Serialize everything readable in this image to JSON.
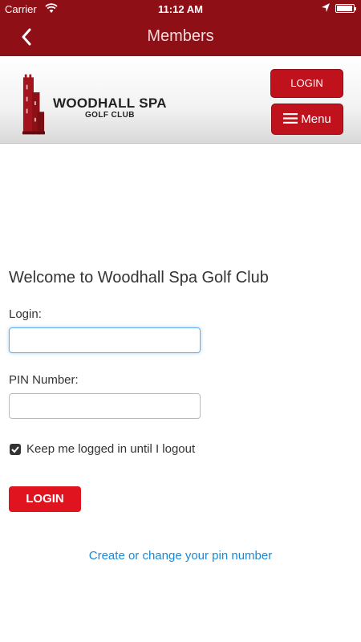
{
  "status_bar": {
    "carrier": "Carrier",
    "time": "11:12 AM"
  },
  "nav": {
    "title": "Members"
  },
  "header": {
    "logo_name": "WOODHALL SPA",
    "logo_sub": "GOLF CLUB",
    "login_label": "LOGIN",
    "menu_label": "Menu"
  },
  "form": {
    "welcome": "Welcome to Woodhall Spa Golf Club",
    "login_label": "Login:",
    "login_value": "",
    "pin_label": "PIN Number:",
    "pin_value": "",
    "keep_logged_in_label": "Keep me logged in until I logout",
    "keep_logged_in_checked": true,
    "submit_label": "LOGIN",
    "pin_link": "Create or change your pin number"
  },
  "colors": {
    "brand": "#8f0f16",
    "button": "#c0121d",
    "submit": "#e0141f",
    "link": "#1a8ad6"
  },
  "icons": [
    "wifi-icon",
    "location-icon",
    "battery-icon",
    "back-chevron-icon",
    "hamburger-icon",
    "checkmark-icon",
    "club-logo-tower"
  ]
}
